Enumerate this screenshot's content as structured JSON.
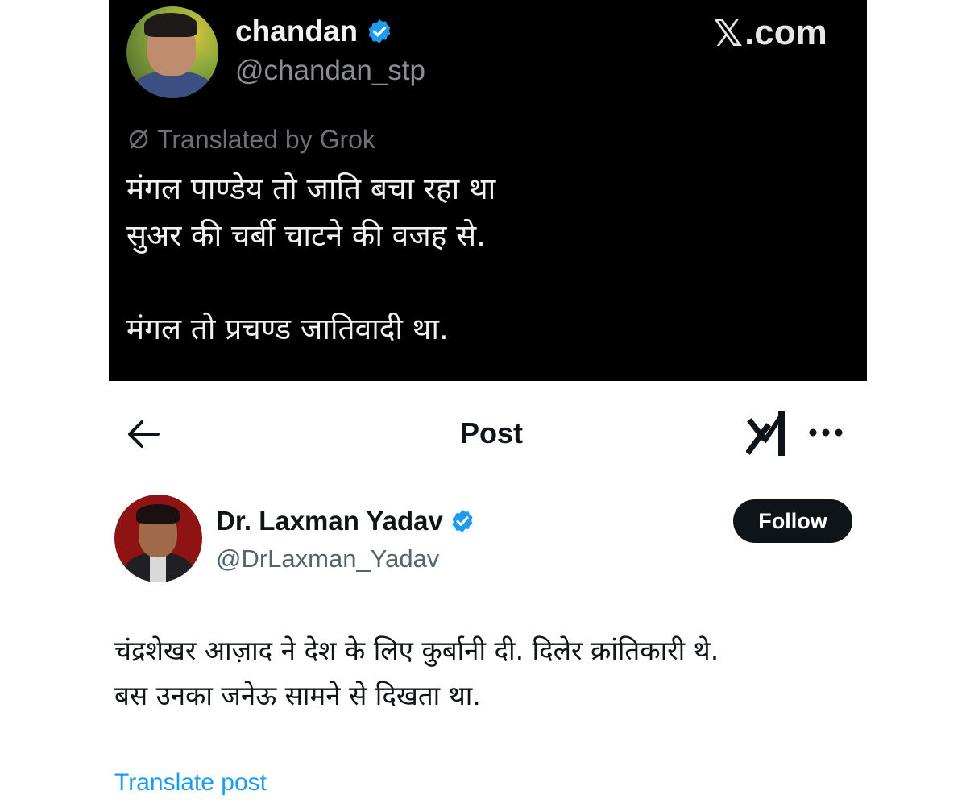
{
  "top_post": {
    "display_name": "chandan",
    "handle": "@chandan_stp",
    "brand": ".com",
    "brand_logo": "𝕏",
    "translated_label": "Translated by Grok",
    "lines": [
      "मंगल पाण्डेय तो जाति बचा रहा था",
      "सुअर की चर्बी चाटने की वजह से.",
      "मंगल तो प्रचण्ड जातिवादी था."
    ]
  },
  "header": {
    "title": "Post"
  },
  "bottom_post": {
    "display_name": "Dr. Laxman Yadav",
    "handle": "@DrLaxman_Yadav",
    "follow_label": "Follow",
    "lines": [
      "चंद्रशेखर आज़ाद ने देश के लिए कुर्बानी दी. दिलेर क्रांतिकारी थे.",
      "बस उनका जनेऊ सामने से दिखता था."
    ],
    "translate_label": "Translate post"
  },
  "icons": {
    "back": "back-arrow-icon",
    "grok": "grok-icon",
    "more": "more-icon",
    "verified": "verified-badge-icon",
    "translated": "grok-slash-icon"
  },
  "colors": {
    "verified_blue": "#1d9bf0",
    "link_blue": "#1d9bf0",
    "dark_bg": "#000000",
    "follow_bg": "#0f1419"
  }
}
